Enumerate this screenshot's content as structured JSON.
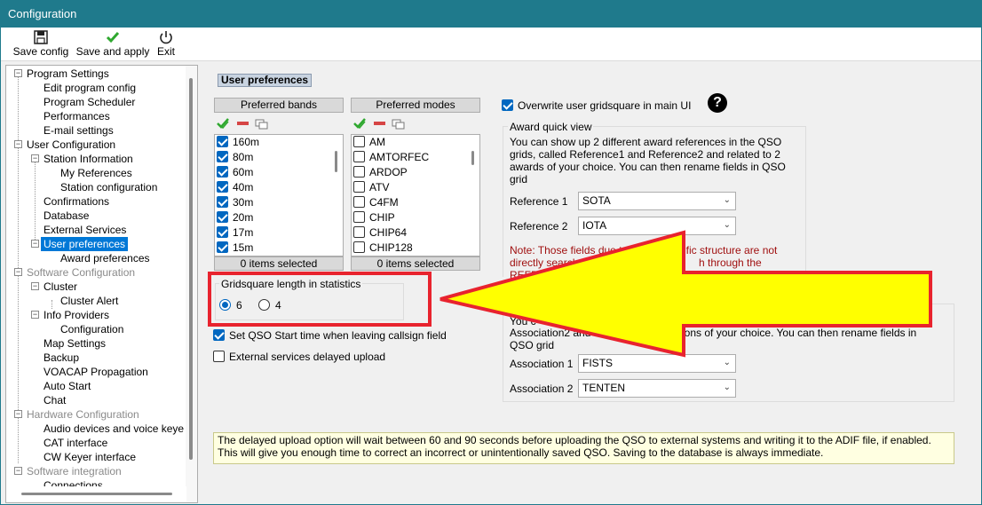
{
  "window": {
    "title": "Configuration"
  },
  "toolbar": {
    "save_config": "Save config",
    "save_apply": "Save and apply",
    "exit": "Exit"
  },
  "tree": {
    "items": [
      "Program Settings",
      "Edit program config",
      "Program Scheduler",
      "Performances",
      "E-mail settings",
      "User Configuration",
      "Station Information",
      "My References",
      "Station configuration",
      "Confirmations",
      "Database",
      "External Services",
      "User preferences",
      "Award preferences",
      "Software Configuration",
      "Cluster",
      "Cluster Alert",
      "Info Providers",
      "Configuration",
      "Map Settings",
      "Backup",
      "VOACAP Propagation",
      "Auto Start",
      "Chat",
      "Hardware Configuration",
      "Audio devices and voice keye",
      "CAT interface",
      "CW Keyer interface",
      "Software integration",
      "Connections"
    ],
    "selected": "User preferences"
  },
  "main": {
    "section_title": "User preferences",
    "bands": {
      "header": "Preferred bands",
      "items": [
        "160m",
        "80m",
        "60m",
        "40m",
        "30m",
        "20m",
        "17m",
        "15m"
      ],
      "footer": "0 items selected"
    },
    "modes": {
      "header": "Preferred modes",
      "items": [
        "AM",
        "AMTORFEC",
        "ARDOP",
        "ATV",
        "C4FM",
        "CHIP",
        "CHIP64",
        "CHIP128"
      ],
      "footer": "0 items selected"
    },
    "gridsquare": {
      "title": "Gridsquare length in statistics",
      "option_6": "6",
      "option_4": "4",
      "selected": "6"
    },
    "set_qso_start": "Set QSO Start time when leaving callsign field",
    "external_delayed": "External services delayed upload",
    "overwrite_grid": "Overwrite user gridsquare in main UI",
    "award": {
      "title": "Award quick view",
      "description": "You can show up 2 different award references in the QSO grids, called Reference1 and Reference2 and related to 2 awards of your choice. You can then rename fields in QSO grid",
      "ref1_label": "Reference 1",
      "ref1_value": "SOTA",
      "ref2_label": "Reference 2",
      "ref2_value": "IOTA",
      "note_a": "Note: Those fields due to their",
      "note_b": "ific structure are not",
      "note_c": "directly searchable. ",
      "note_d": "h through the",
      "note_e": "REFERENC"
    },
    "association": {
      "desc_a": "You c",
      "desc_b": "Association2 and",
      "desc_c": "ations of your choice. You can then rename fields in",
      "desc_d": "QSO grid",
      "assoc1_label": "Association 1",
      "assoc1_value": "FISTS",
      "assoc2_label": "Association 2",
      "assoc2_value": "TENTEN"
    },
    "info": "The delayed upload option will wait between 60 and 90 seconds before uploading the QSO to external systems and writing it to the ADIF file, if enabled. This will give you enough time to correct an incorrect or unintentionally saved QSO. Saving to the database is always immediate."
  },
  "colors": {
    "titlebar": "#1f7a8c",
    "selection": "#0078d7",
    "annotation_red": "#e8232e",
    "annotation_yellow": "#ffff00"
  }
}
